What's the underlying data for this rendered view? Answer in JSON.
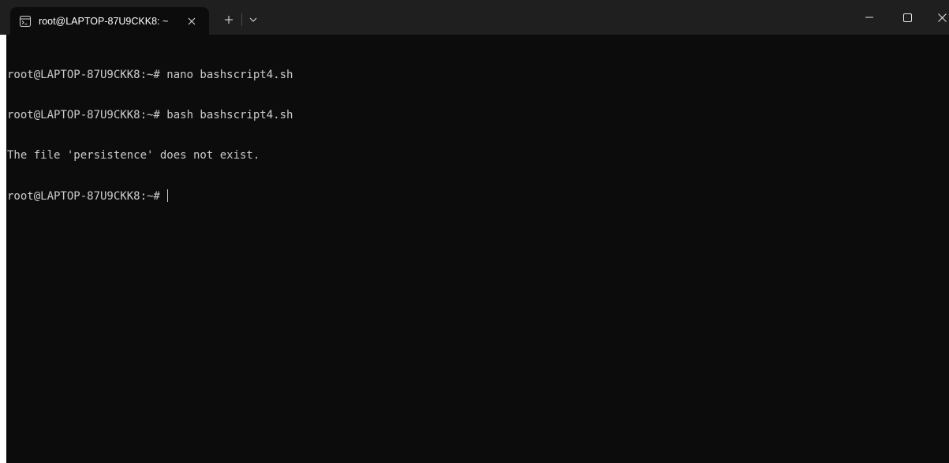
{
  "window": {
    "tab_title": "root@LAPTOP-87U9CKK8: ~",
    "tab_icon": "terminal-icon",
    "new_tab_symbol": "+",
    "dropdown_symbol": "chevron-down-icon",
    "controls": [
      "minimize-icon",
      "maximize-icon",
      "close-icon"
    ]
  },
  "terminal": {
    "lines": [
      "root@LAPTOP-87U9CKK8:~# nano bashscript4.sh",
      "root@LAPTOP-87U9CKK8:~# bash bashscript4.sh",
      "The file 'persistence' does not exist."
    ],
    "prompt": "root@LAPTOP-87U9CKK8:~# "
  },
  "colors": {
    "titlebar": "#1f1f1f",
    "terminal_bg": "#0c0c0c",
    "terminal_fg": "#cccccc"
  }
}
